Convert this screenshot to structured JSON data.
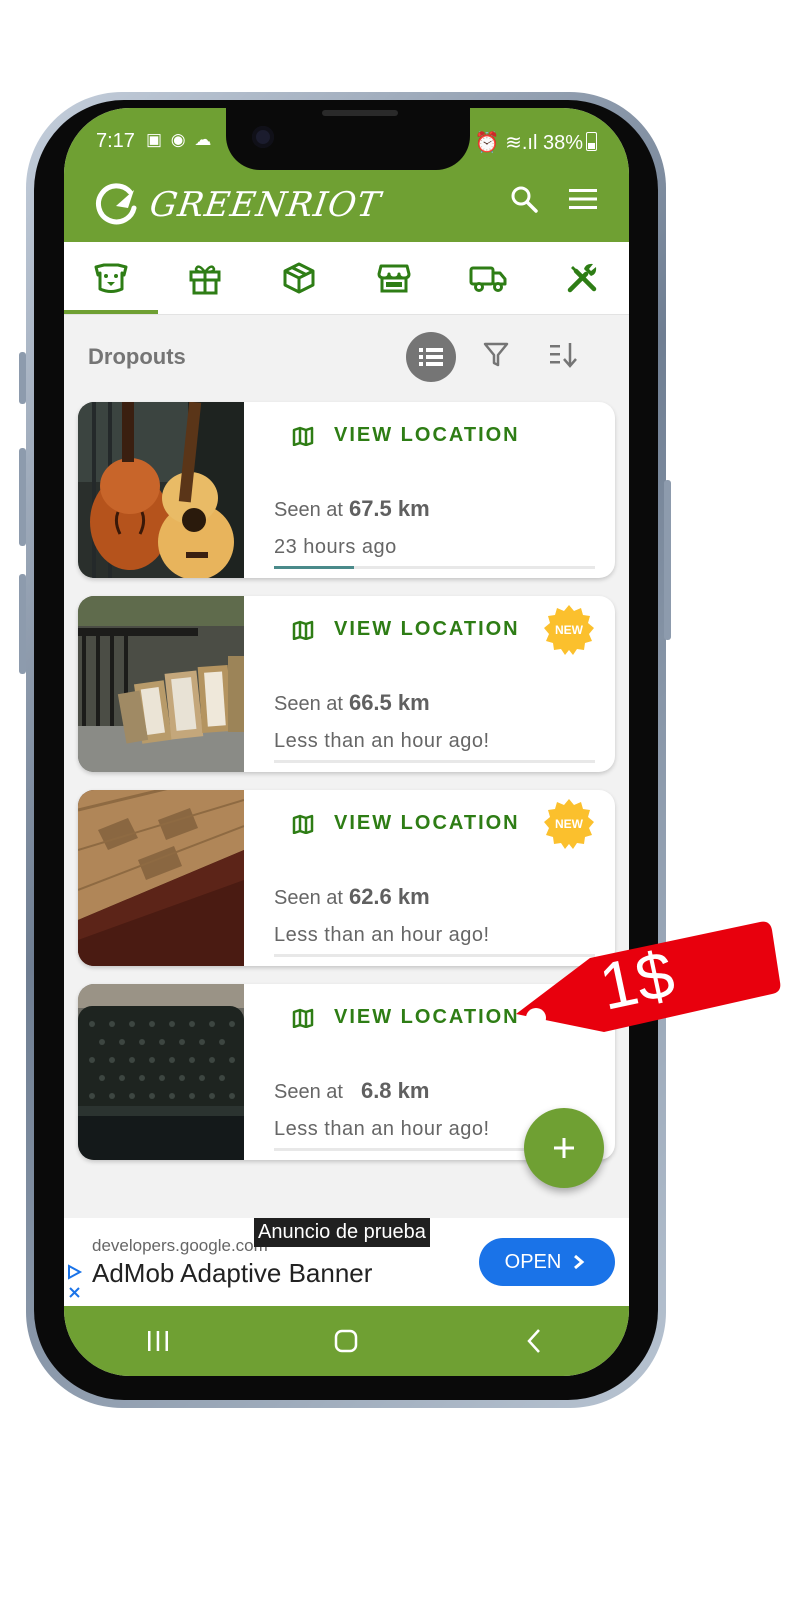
{
  "status_bar": {
    "time": "7:17",
    "icons": "▣ ◉ ☁",
    "right": "⏰ ≋.ıl",
    "battery": "38%"
  },
  "app": {
    "name": "GREENRIOT"
  },
  "tabs": [
    "dog-face",
    "gift",
    "package",
    "storefront",
    "truck",
    "tools"
  ],
  "toolbar": {
    "title": "Dropouts"
  },
  "cards": [
    {
      "image": "guitars",
      "action": "VIEW LOCATION",
      "seen_prefix": "Seen at",
      "distance": "67.5 km",
      "time": "23 hours ago",
      "progress": 0.25,
      "is_new": false
    },
    {
      "image": "framed-pictures",
      "action": "VIEW LOCATION",
      "seen_prefix": "Seen at",
      "distance": "66.5 km",
      "time": "Less than an hour ago!",
      "progress": 0,
      "is_new": true,
      "badge": "NEW"
    },
    {
      "image": "wooden-furniture",
      "action": "VIEW LOCATION",
      "seen_prefix": "Seen at",
      "distance": "62.6 km",
      "time": "Less than an hour ago!",
      "progress": 0,
      "is_new": true,
      "badge": "NEW"
    },
    {
      "image": "leather-sofa",
      "action": "VIEW LOCATION",
      "seen_prefix": "Seen at",
      "distance": "6.8 km",
      "time": "Less than an hour ago!",
      "progress": 0,
      "is_new": false
    }
  ],
  "fab": {
    "icon": "plus-icon",
    "label": "+"
  },
  "ad": {
    "tag": "Anuncio de prueba",
    "domain": "developers.google.com",
    "title": "AdMob Adaptive Banner",
    "button": "OPEN"
  },
  "price_tag": {
    "text": "1$",
    "color": "#e8000d"
  },
  "colors": {
    "brand_green": "#6fa033",
    "action_green": "#2e7d15",
    "badge_yellow": "#fbc02d",
    "ad_blue": "#1a73e8"
  }
}
